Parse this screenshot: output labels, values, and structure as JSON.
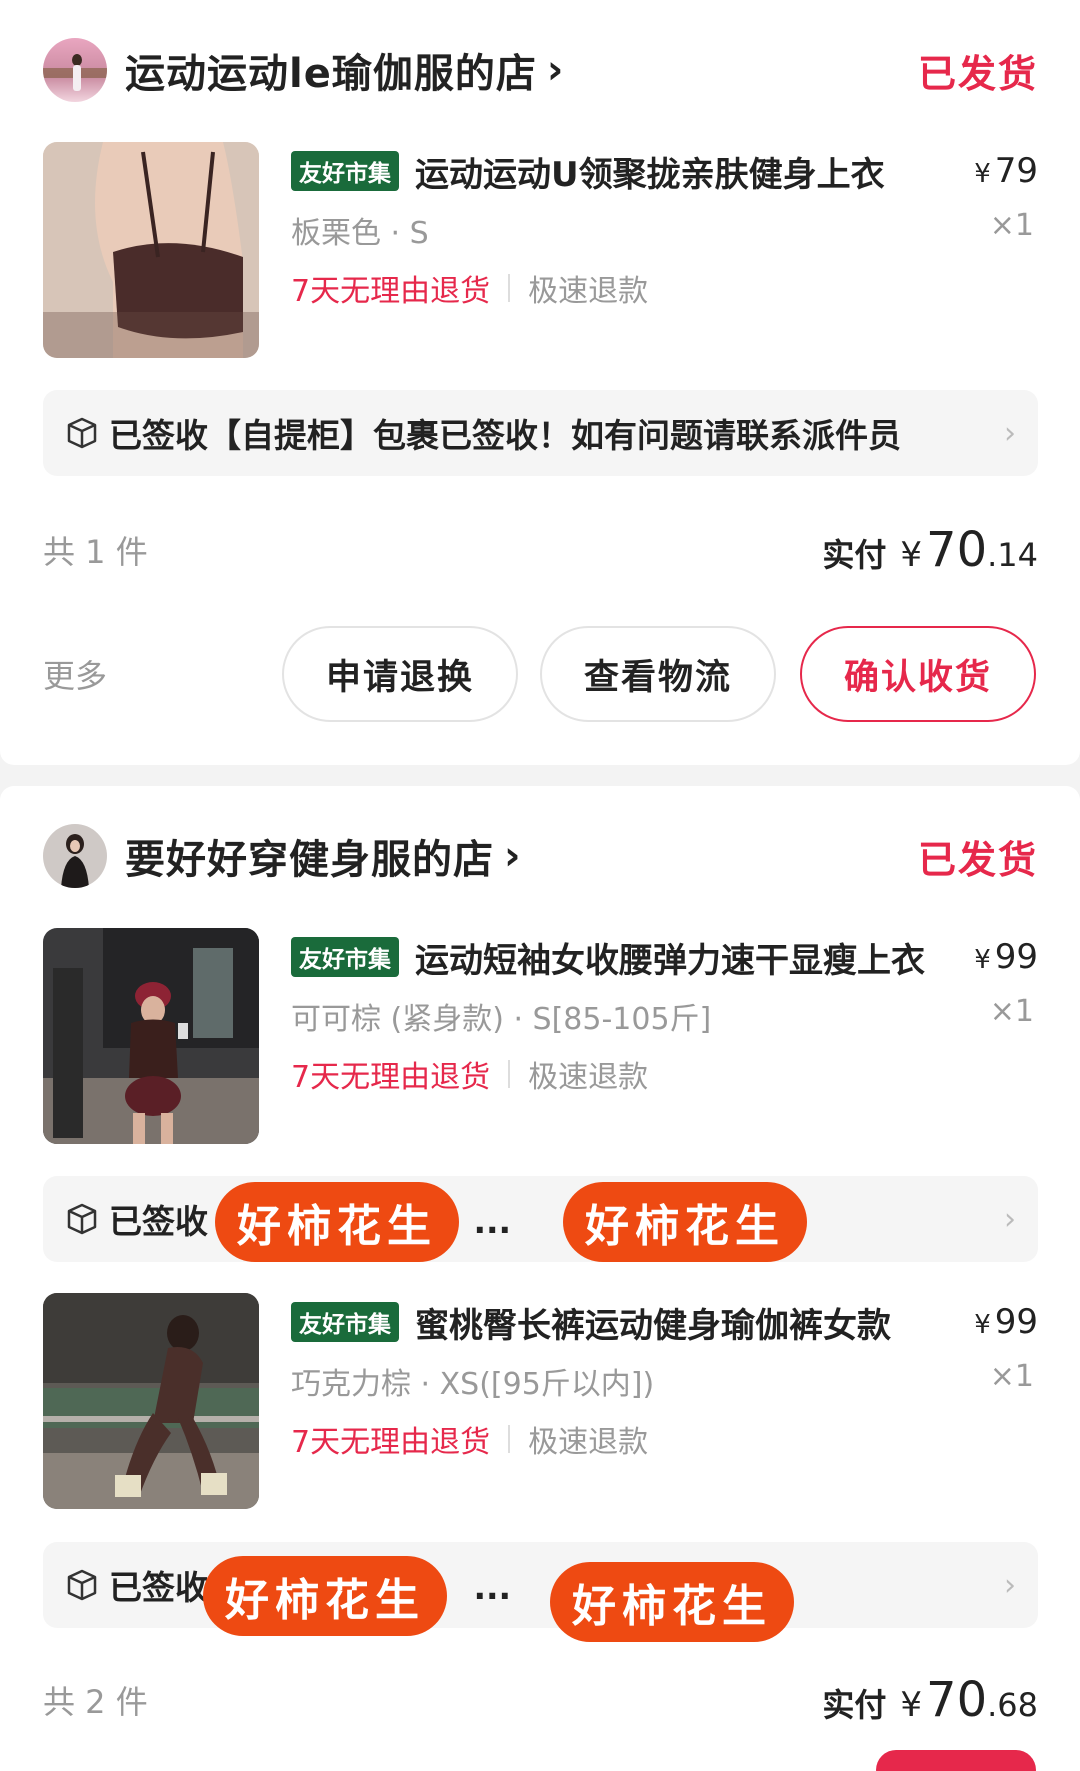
{
  "orders": [
    {
      "shop_name": "运动运动le瑜伽服的店",
      "status": "已发货",
      "items": [
        {
          "tag": "友好市集",
          "title": "运动运动U领聚拢亲肤健身上衣",
          "price": "79",
          "spec": "板栗色 · S",
          "qty": "×1",
          "service_return": "7天无理由退货",
          "service_refund": "极速退款"
        }
      ],
      "logistics": "已签收【自提柜】包裹已签收！如有问题请联系派件员",
      "count": "共 1 件",
      "paid_label": "实付",
      "paid_yen": "¥",
      "paid_int": "70",
      "paid_dec": ".14",
      "more": "更多",
      "buttons": [
        "申请退换",
        "查看物流",
        "确认收货"
      ]
    },
    {
      "shop_name": "要好好穿健身服的店",
      "status": "已发货",
      "items": [
        {
          "tag": "友好市集",
          "title": "运动短袖女收腰弹力速干显瘦上衣",
          "price": "99",
          "spec": "可可棕 (紧身款) · S[85-105斤]",
          "qty": "×1",
          "service_return": "7天无理由退货",
          "service_refund": "极速退款",
          "logistics": "已签收 快递已由 平台， ..."
        },
        {
          "tag": "友好市集",
          "title": "蜜桃臀长裤运动健身瑜伽裤女款",
          "price": "99",
          "spec": "巧克力棕 · XS([95斤以内])",
          "qty": "×1",
          "service_return": "7天无理由退货",
          "service_refund": "极速退款",
          "logistics": "已签收 快递已由 平台， ..."
        }
      ],
      "count": "共 2 件",
      "paid_label": "实付",
      "paid_yen": "¥",
      "paid_int": "70",
      "paid_dec": ".68"
    }
  ],
  "watermark": "好柿花生",
  "icons": {
    "shop_chevron": "chevron-right-icon",
    "logistics_box": "package-box-icon",
    "logistics_chevron": "chevron-right-icon"
  },
  "colors": {
    "accent": "#e6284b",
    "tag_bg": "#1a6b3b",
    "watermark_bg": "#ee4a12"
  }
}
